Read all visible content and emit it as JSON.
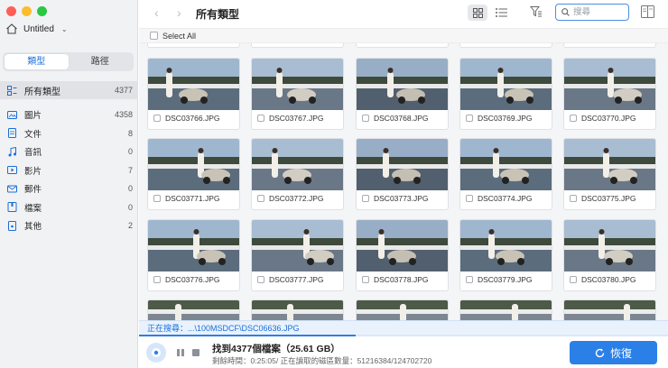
{
  "window": {
    "project_name": "Untitled"
  },
  "sidebar": {
    "tabs": [
      {
        "label": "類型",
        "active": true
      },
      {
        "label": "路徑",
        "active": false
      }
    ],
    "all_types": {
      "label": "所有類型",
      "count": "4377"
    },
    "items": [
      {
        "label": "圖片",
        "count": "4358",
        "icon": "image-icon"
      },
      {
        "label": "文件",
        "count": "8",
        "icon": "document-icon"
      },
      {
        "label": "音訊",
        "count": "0",
        "icon": "music-icon"
      },
      {
        "label": "影片",
        "count": "7",
        "icon": "video-icon"
      },
      {
        "label": "郵件",
        "count": "0",
        "icon": "mail-icon"
      },
      {
        "label": "檔案",
        "count": "0",
        "icon": "archive-icon"
      },
      {
        "label": "其他",
        "count": "2",
        "icon": "other-icon"
      }
    ]
  },
  "toolbar": {
    "title": "所有類型",
    "search_placeholder": "搜尋"
  },
  "select_all": {
    "label": "Select All"
  },
  "files": [
    "DSC03766.JPG",
    "DSC03767.JPG",
    "DSC03768.JPG",
    "DSC03769.JPG",
    "DSC03770.JPG",
    "DSC03771.JPG",
    "DSC03772.JPG",
    "DSC03773.JPG",
    "DSC03774.JPG",
    "DSC03775.JPG",
    "DSC03776.JPG",
    "DSC03777.JPG",
    "DSC03778.JPG",
    "DSC03779.JPG",
    "DSC03780.JPG"
  ],
  "status": {
    "searching": "正在搜尋：...\\100MSDCF\\DSC06636.JPG",
    "found": "找到4377個檔案（25.61 GB）",
    "detail": "剩餘時間：0:25:05/ 正在讀取的磁區數量：51216384/124702720",
    "progress": 0.41
  },
  "recover_button": {
    "label": "恢復"
  },
  "colors": {
    "accent": "#2b80e8",
    "status_text": "#1a6ed8"
  }
}
